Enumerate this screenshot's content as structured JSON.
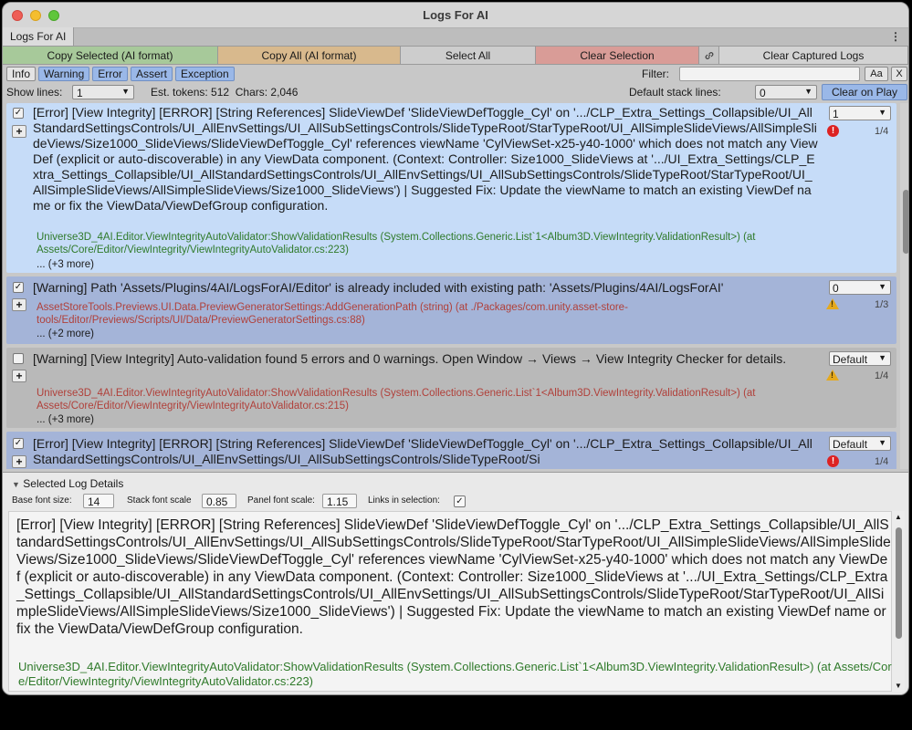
{
  "window": {
    "title": "Logs For AI"
  },
  "tab": {
    "label": "Logs For AI",
    "menu_icon": "kebab-menu-icon"
  },
  "toolbar": {
    "copy_selected": "Copy Selected (AI format)",
    "copy_all": "Copy All (AI format)",
    "select_all": "Select All",
    "clear_selection": "Clear Selection",
    "link_icon": "link-icon",
    "clear_captured": "Clear Captured Logs"
  },
  "filters": {
    "chips": [
      {
        "label": "Info",
        "active": false
      },
      {
        "label": "Warning",
        "active": true
      },
      {
        "label": "Error",
        "active": true
      },
      {
        "label": "Assert",
        "active": true
      },
      {
        "label": "Exception",
        "active": true
      }
    ],
    "filter_label": "Filter:",
    "filter_value": "",
    "match_case": "Aa",
    "clear": "X"
  },
  "show": {
    "show_lines_label": "Show lines:",
    "show_lines_value": "1",
    "tokens": "Est. tokens: 512",
    "chars": "Chars: 2,046",
    "default_stack_label": "Default stack lines:",
    "default_stack_value": "0",
    "clear_on_play": "Clear on Play"
  },
  "logs": [
    {
      "checked": true,
      "type": "error",
      "message": "[Error] [View Integrity] [ERROR] [String References] SlideViewDef 'SlideViewDefToggle_Cyl' on '.../CLP_Extra_Settings_Collapsible/UI_AllStandardSettingsControls/UI_AllEnvSettings/UI_AllSubSettingsControls/SlideTypeRoot/StarTypeRoot/UI_AllSimpleSlideViews/AllSimpleSlideViews/Size1000_SlideViews/SlideViewDefToggle_Cyl' references viewName 'CylViewSet-x25-y40-1000' which does not match any ViewDef (explicit or auto-discoverable) in any ViewData component. (Context: Controller: Size1000_SlideViews at '.../UI_Extra_Settings/CLP_Extra_Settings_Collapsible/UI_AllStandardSettingsControls/UI_AllEnvSettings/UI_AllSubSettingsControls/SlideTypeRoot/StarTypeRoot/UI_AllSimpleSlideViews/AllSimpleSlideViews/Size1000_SlideViews') | Suggested Fix: Update the viewName to match an existing ViewDef name or fix the ViewData/ViewDefGroup configuration.",
      "stack": "Universe3D_4AI.Editor.ViewIntegrityAutoValidator:ShowValidationResults (System.Collections.Generic.List`1<Album3D.ViewIntegrity.ValidationResult>) (at Assets/Core/Editor/ViewIntegrity/ViewIntegrityAutoValidator.cs:223)",
      "more": "... (+3 more)",
      "lines": "1",
      "count": "1/4"
    },
    {
      "checked": true,
      "type": "warning",
      "message": "[Warning] Path 'Assets/Plugins/4AI/LogsForAI/Editor' is already included with existing path: 'Assets/Plugins/4AI/LogsForAI'",
      "stack": "AssetStoreTools.Previews.UI.Data.PreviewGeneratorSettings:AddGenerationPath (string) (at ./Packages/com.unity.asset-store-tools/Editor/Previews/Scripts/UI/Data/PreviewGeneratorSettings.cs:88)",
      "more": "... (+2 more)",
      "lines": "0",
      "count": "1/3"
    },
    {
      "checked": false,
      "type": "warning",
      "message": "[Warning] [View Integrity] Auto-validation found 5 errors and 0 warnings. Open Window → Views → View Integrity Checker for details.",
      "stack": "Universe3D_4AI.Editor.ViewIntegrityAutoValidator:ShowValidationResults (System.Collections.Generic.List`1<Album3D.ViewIntegrity.ValidationResult>) (at Assets/Core/Editor/ViewIntegrity/ViewIntegrityAutoValidator.cs:215)",
      "more": "... (+3 more)",
      "lines": "Default",
      "count": "1/4"
    },
    {
      "checked": true,
      "type": "error",
      "message": "[Error] [View Integrity] [ERROR] [String References] SlideViewDef 'SlideViewDefToggle_Cyl' on '.../CLP_Extra_Settings_Collapsible/UI_AllStandardSettingsControls/UI_AllEnvSettings/UI_AllSubSettingsControls/SlideTypeRoot/Si",
      "lines": "Default",
      "count": "1/4"
    }
  ],
  "details": {
    "header": "Selected Log Details",
    "base_font_label": "Base font size:",
    "base_font_value": "14",
    "stack_scale_label": "Stack font scale",
    "stack_scale_value": "0.85",
    "panel_scale_label": "Panel font scale:",
    "panel_scale_value": "1.15",
    "links_label": "Links in selection:",
    "links_checked": true,
    "message": "[Error] [View Integrity] [ERROR] [String References] SlideViewDef 'SlideViewDefToggle_Cyl' on '.../CLP_Extra_Settings_Collapsible/UI_AllStandardSettingsControls/UI_AllEnvSettings/UI_AllSubSettingsControls/SlideTypeRoot/StarTypeRoot/UI_AllSimpleSlideViews/AllSimpleSlideViews/Size1000_SlideViews/SlideViewDefToggle_Cyl' references viewName 'CylViewSet-x25-y40-1000' which does not match any ViewDef (explicit or auto-discoverable) in any ViewData component. (Context: Controller: Size1000_SlideViews at '.../UI_Extra_Settings/CLP_Extra_Settings_Collapsible/UI_AllStandardSettingsControls/UI_AllEnvSettings/UI_AllSubSettingsControls/SlideTypeRoot/StarTypeRoot/UI_AllSimpleSlideViews/AllSimpleSlideViews/Size1000_SlideViews') | Suggested Fix: Update the viewName to match an existing ViewDef name or fix the ViewData/ViewDefGroup configuration.",
    "stack": "Universe3D_4AI.Editor.ViewIntegrityAutoValidator:ShowValidationResults (System.Collections.Generic.List`1<Album3D.ViewIntegrity.ValidationResult>) (at Assets/Core/Editor/ViewIntegrity/ViewIntegrityAutoValidator.cs:223)"
  }
}
